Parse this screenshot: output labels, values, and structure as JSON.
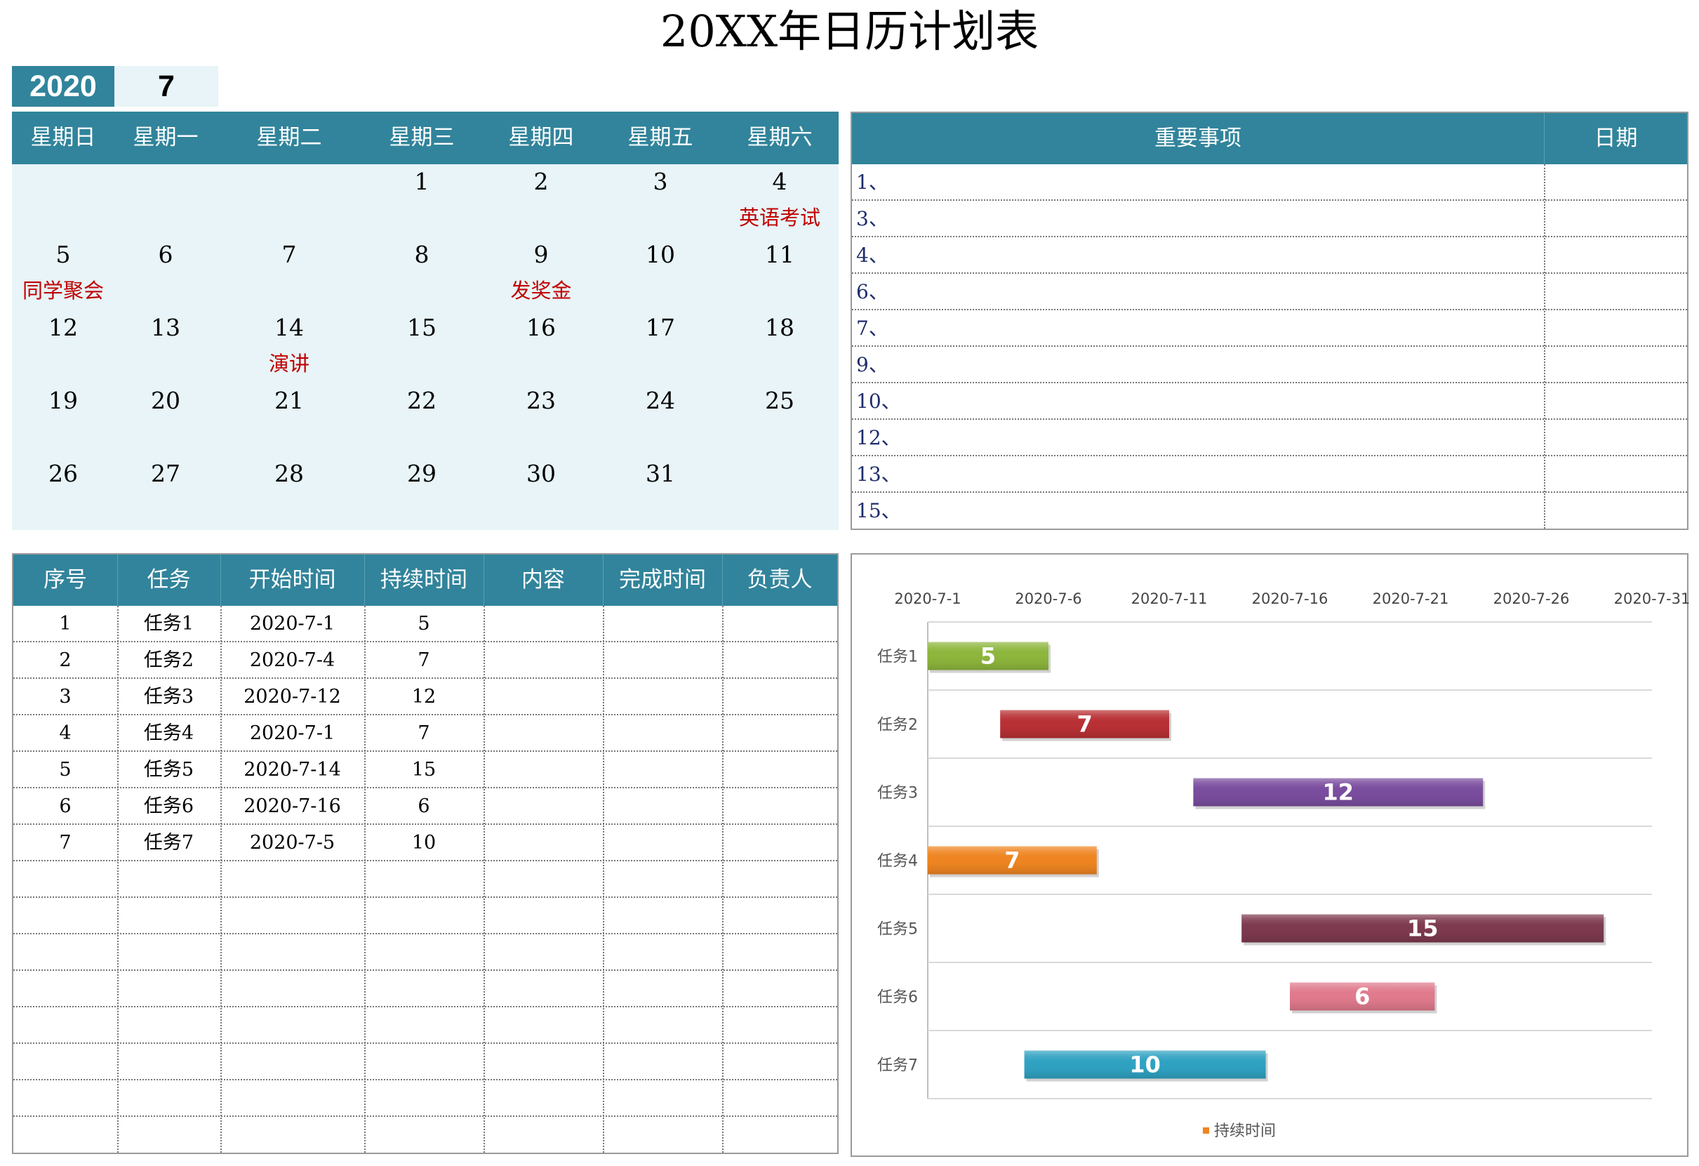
{
  "title": "20XX年日历计划表",
  "year": "2020",
  "month": "7",
  "calendar": {
    "weekdays": [
      "星期日",
      "星期一",
      "星期二",
      "星期三",
      "星期四",
      "星期五",
      "星期六"
    ],
    "weeks": [
      [
        "",
        "",
        "",
        "1",
        "2",
        "3",
        "4"
      ],
      [
        "5",
        "6",
        "7",
        "8",
        "9",
        "10",
        "11"
      ],
      [
        "12",
        "13",
        "14",
        "15",
        "16",
        "17",
        "18"
      ],
      [
        "19",
        "20",
        "21",
        "22",
        "23",
        "24",
        "25"
      ],
      [
        "26",
        "27",
        "28",
        "29",
        "30",
        "31",
        ""
      ]
    ],
    "notes": [
      [
        "",
        "",
        "",
        "",
        "",
        "",
        "英语考试"
      ],
      [
        "同学聚会",
        "",
        "",
        "",
        "发奖金",
        "",
        ""
      ],
      [
        "",
        "",
        "演讲",
        "",
        "",
        "",
        ""
      ],
      [
        "",
        "",
        "",
        "",
        "",
        "",
        ""
      ],
      [
        "",
        "",
        "",
        "",
        "",
        "",
        ""
      ]
    ]
  },
  "important": {
    "header_item": "重要事项",
    "header_date": "日期",
    "rows": [
      "1、",
      "3、",
      "4、",
      "6、",
      "7、",
      "9、",
      "10、",
      "12、",
      "13、",
      "15、"
    ]
  },
  "tasks": {
    "headers": [
      "序号",
      "任务",
      "开始时间",
      "持续时间",
      "内容",
      "完成时间",
      "负责人"
    ],
    "rows": [
      [
        "1",
        "任务1",
        "2020-7-1",
        "5",
        "",
        "",
        ""
      ],
      [
        "2",
        "任务2",
        "2020-7-4",
        "7",
        "",
        "",
        ""
      ],
      [
        "3",
        "任务3",
        "2020-7-12",
        "12",
        "",
        "",
        ""
      ],
      [
        "4",
        "任务4",
        "2020-7-1",
        "7",
        "",
        "",
        ""
      ],
      [
        "5",
        "任务5",
        "2020-7-14",
        "15",
        "",
        "",
        ""
      ],
      [
        "6",
        "任务6",
        "2020-7-16",
        "6",
        "",
        "",
        ""
      ],
      [
        "7",
        "任务7",
        "2020-7-5",
        "10",
        "",
        "",
        ""
      ],
      [
        "",
        "",
        "",
        "",
        "",
        "",
        ""
      ],
      [
        "",
        "",
        "",
        "",
        "",
        "",
        ""
      ],
      [
        "",
        "",
        "",
        "",
        "",
        "",
        ""
      ],
      [
        "",
        "",
        "",
        "",
        "",
        "",
        ""
      ],
      [
        "",
        "",
        "",
        "",
        "",
        "",
        ""
      ],
      [
        "",
        "",
        "",
        "",
        "",
        "",
        ""
      ],
      [
        "",
        "",
        "",
        "",
        "",
        "",
        ""
      ],
      [
        "",
        "",
        "",
        "",
        "",
        "",
        ""
      ]
    ]
  },
  "chart_data": {
    "type": "bar",
    "orientation": "horizontal-gantt",
    "categories": [
      "任务1",
      "任务2",
      "任务3",
      "任务4",
      "任务5",
      "任务6",
      "任务7"
    ],
    "start": [
      "2020-7-1",
      "2020-7-4",
      "2020-7-12",
      "2020-7-1",
      "2020-7-14",
      "2020-7-16",
      "2020-7-5"
    ],
    "series": [
      {
        "name": "持续时间",
        "values": [
          5,
          7,
          12,
          7,
          15,
          6,
          10
        ]
      }
    ],
    "x_ticks": [
      "2020-7-1",
      "2020-7-6",
      "2020-7-11",
      "2020-7-16",
      "2020-7-21",
      "2020-7-26",
      "2020-7-31"
    ],
    "xlim": [
      "2020-7-1",
      "2020-7-31"
    ],
    "x_axis_position": "top",
    "grid": true,
    "legend": "bottom",
    "bar_colors": [
      "#8db63c",
      "#b83034",
      "#7a4d9e",
      "#ee8521",
      "#7e3a4f",
      "#e07a8c",
      "#2fa2c2"
    ],
    "data_labels": true
  },
  "colors": {
    "header": "#31849b",
    "calendar_bg": "#e8f4f7",
    "note": "#c00000"
  }
}
